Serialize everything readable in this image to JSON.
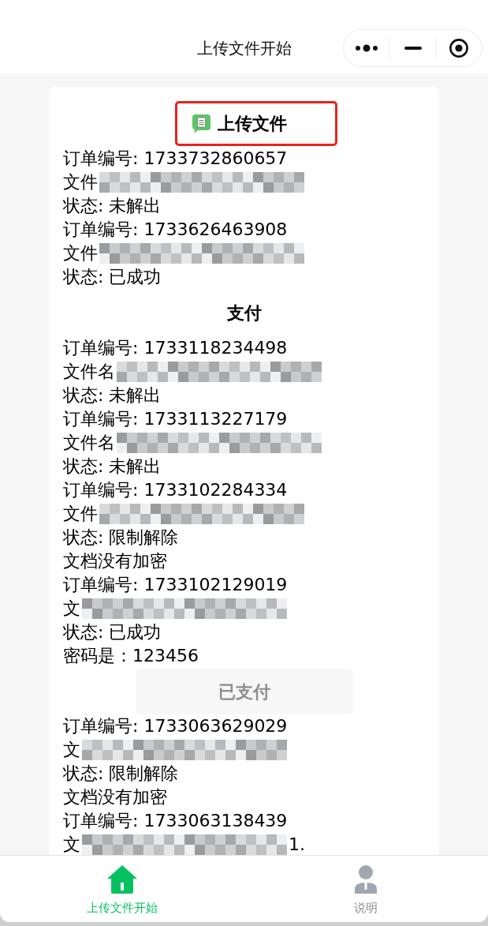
{
  "nav_bar": {
    "title": "上传文件开始"
  },
  "sections": [
    {
      "heading": "上传文件",
      "highlighted": true,
      "has_icon": true,
      "orders": [
        {
          "order_number": "订单编号: 1733732860657",
          "file_label": "文件",
          "status": "状态: 未解出"
        },
        {
          "order_number": "订单编号: 1733626463908",
          "file_label": "文件",
          "status": "状态: 已成功"
        }
      ]
    },
    {
      "heading": "支付",
      "highlighted": false,
      "has_icon": false,
      "orders": [
        {
          "order_number": "订单编号: 1733118234498",
          "file_label": "文件名",
          "status": "状态: 未解出"
        },
        {
          "order_number": "订单编号: 1733113227179",
          "file_label": "文件名",
          "status": "状态: 未解出"
        },
        {
          "order_number": "订单编号: 1733102284334",
          "file_label": "文件",
          "status": "状态: 限制解除",
          "notes": [
            "文档没有加密"
          ]
        },
        {
          "order_number": "订单编号: 1733102129019",
          "file_label": "文",
          "status": "状态: 已成功",
          "notes": [
            "密码是：123456"
          ],
          "button": {
            "label": "已支付",
            "disabled": true
          }
        },
        {
          "order_number": "订单编号: 1733063629029",
          "file_label": "文",
          "status": "状态: 限制解除",
          "notes": [
            "文档没有加密"
          ]
        },
        {
          "order_number": "订单编号: 1733063138439",
          "file_label": "文",
          "file_suffix": "1."
        }
      ]
    }
  ],
  "tab_bar": {
    "items": [
      {
        "label": "上传文件开始",
        "selected": true
      },
      {
        "label": "说明",
        "selected": false
      }
    ]
  }
}
